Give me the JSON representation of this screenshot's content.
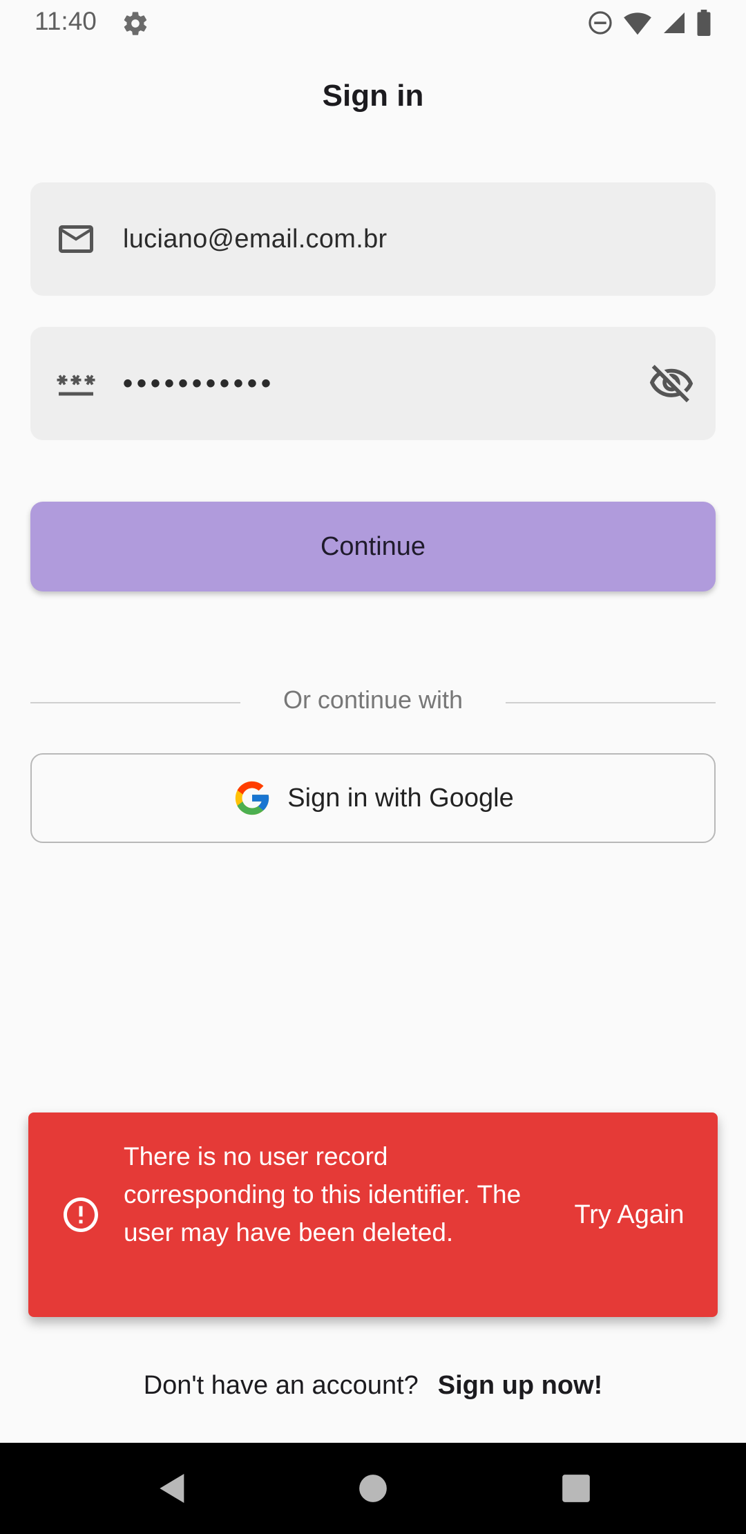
{
  "status_bar": {
    "time": "11:40",
    "icons": [
      "gear-icon",
      "do-not-disturb-icon",
      "wifi-icon",
      "cellular-signal-icon",
      "battery-icon"
    ]
  },
  "header": {
    "title": "Sign in"
  },
  "form": {
    "email": {
      "icon": "mail-icon",
      "value": "luciano@email.com.br"
    },
    "password": {
      "icon": "password-icon",
      "value": "•••••••••••",
      "toggle_icon": "visibility-off-icon"
    },
    "continue_label": "Continue"
  },
  "divider": {
    "text": "Or continue with"
  },
  "google_button": {
    "icon": "google-logo-icon",
    "label": "Sign in with Google"
  },
  "snackbar": {
    "icon": "error-icon",
    "message": "There is no user record corresponding to this identifier. The user may have been deleted.",
    "action": "Try Again",
    "background": "#e53a37"
  },
  "footer": {
    "prompt": "Don't have an account?",
    "link": "Sign up now!"
  },
  "colors": {
    "accent": "#b09bdc",
    "error": "#e53a37",
    "background": "#fafafa"
  },
  "nav_bar": {
    "icons": [
      "back-icon",
      "home-icon",
      "recents-icon"
    ]
  }
}
